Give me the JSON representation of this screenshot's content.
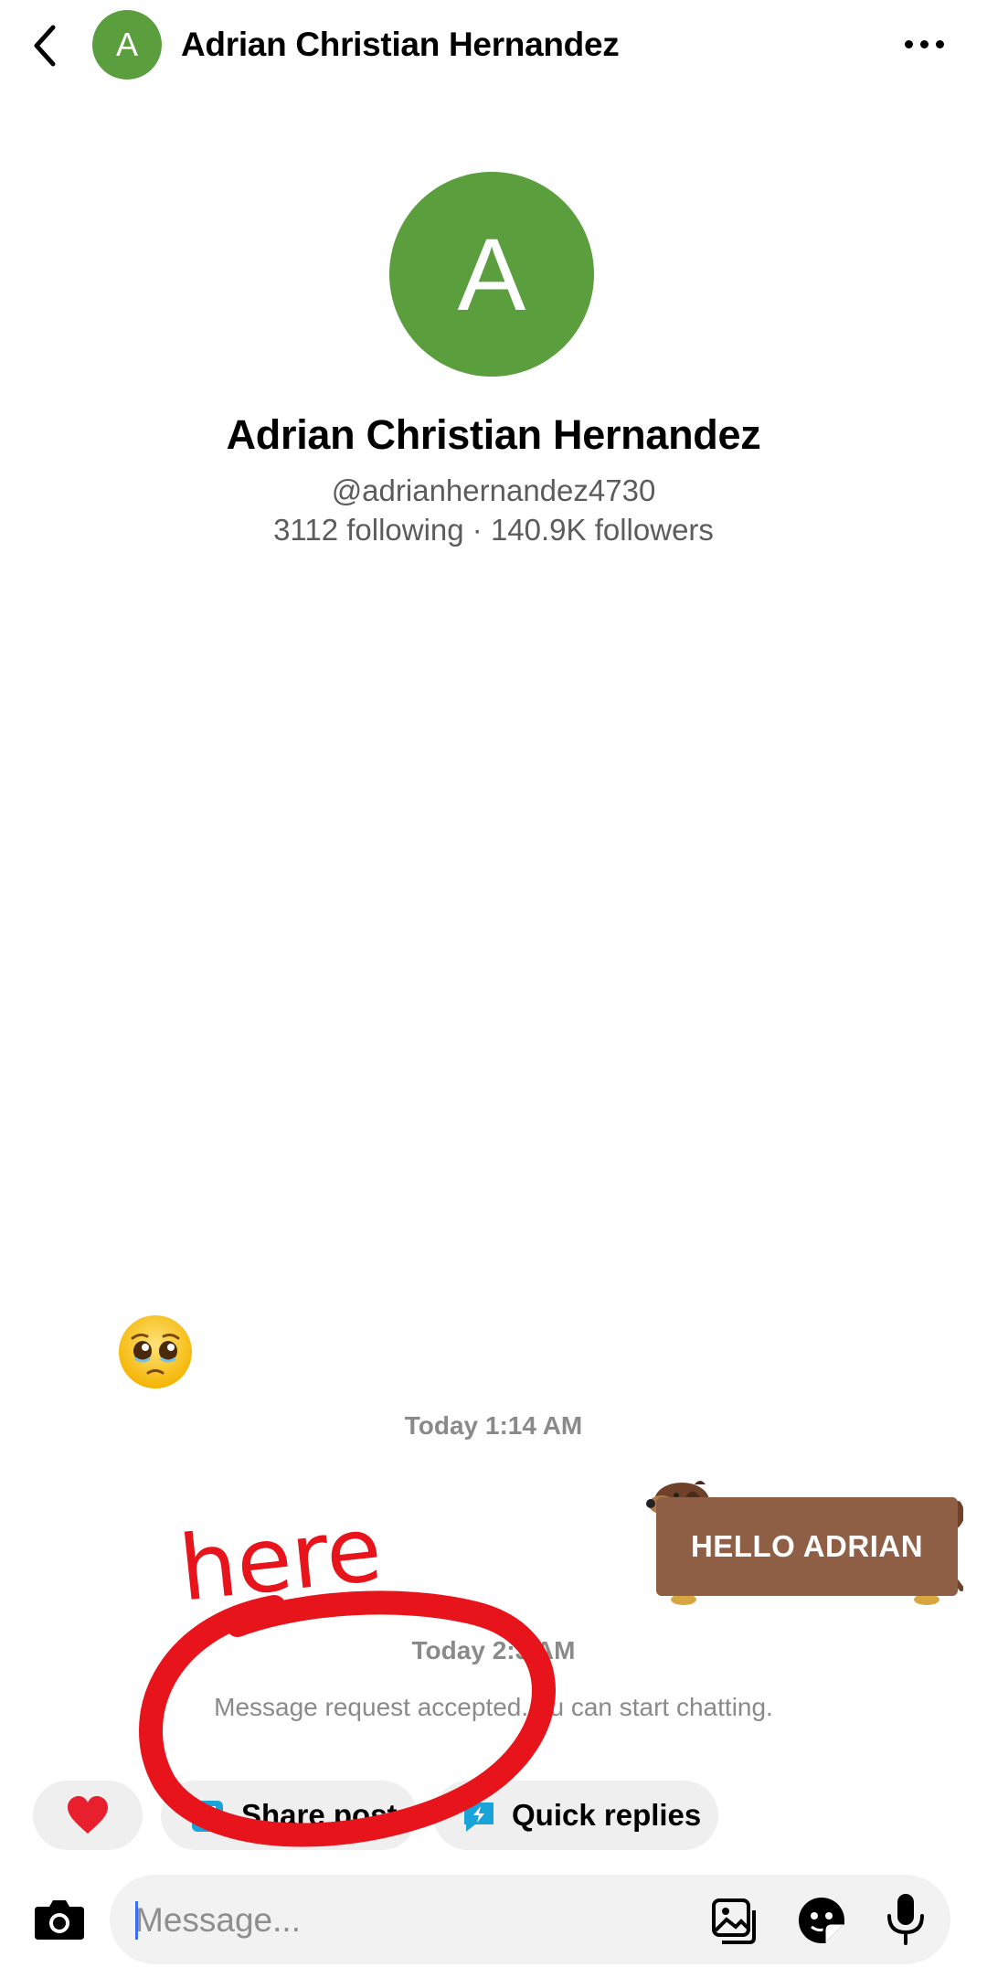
{
  "header": {
    "back_icon": "chevron-left-icon",
    "avatar_initial": "A",
    "title": "Adrian Christian Hernandez",
    "more_icon": "more-horizontal-icon"
  },
  "profile": {
    "avatar_initial": "A",
    "name": "Adrian Christian Hernandez",
    "handle": "@adrianhernandez4730",
    "stats": "3112 following · 140.9K followers"
  },
  "messages": {
    "emoji": "pleading-face-emoji",
    "timestamp_1": "Today 1:14 AM",
    "sticker_text": "HELLO ADRIAN",
    "timestamp_2": "Today 2:3 AM",
    "system_text": "Message request accepted. ou can start chatting."
  },
  "quick_actions": {
    "heart_icon": "heart-icon",
    "share_label": "Share post",
    "quick_replies_label": "Quick replies"
  },
  "composer": {
    "placeholder": "Message...",
    "camera_icon": "camera-icon",
    "gallery_icon": "gallery-icon",
    "sticker_icon": "sticker-icon",
    "mic_icon": "microphone-icon"
  },
  "annotation": {
    "text": "here",
    "color": "#e8141c"
  },
  "colors": {
    "avatar": "#5b9e3e",
    "sticker": "#8e5e45",
    "chip_background": "#efefef",
    "secondary_text": "#5c5c5c",
    "accent_blue": "#1aa3d9"
  }
}
